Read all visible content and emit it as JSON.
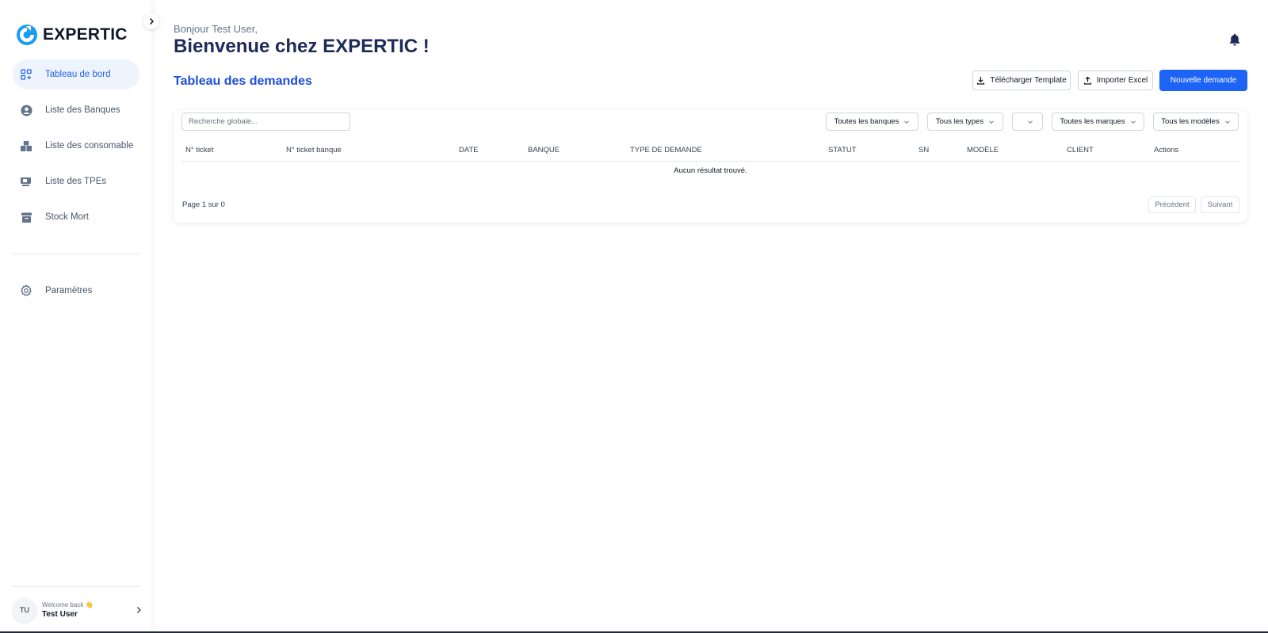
{
  "brand": {
    "name": "EXPERTIC",
    "color": "#1d9bf0"
  },
  "sidebar": {
    "items": [
      {
        "label": "Tableau de bord",
        "icon": "dashboard-grid-icon",
        "active": true
      },
      {
        "label": "Liste des Banques",
        "icon": "user-circle-icon",
        "active": false
      },
      {
        "label": "Liste des consomable",
        "icon": "boxes-icon",
        "active": false
      },
      {
        "label": "Liste des TPEs",
        "icon": "terminal-card-icon",
        "active": false
      },
      {
        "label": "Stock Mort",
        "icon": "archive-box-icon",
        "active": false
      }
    ],
    "settings_label": "Paramètres"
  },
  "user": {
    "initials": "TU",
    "welcome": "Welcome back 👋",
    "name": "Test User"
  },
  "header": {
    "greeting": "Bonjour Test User,",
    "title": "Bienvenue chez EXPERTIC !"
  },
  "section": {
    "title": "Tableau des demandes"
  },
  "actions": {
    "download_template": "Télécharger Template",
    "import_excel": "Importer Excel",
    "new_request": "Nouvelle demande"
  },
  "filters": {
    "search_placeholder": "Recherche globale...",
    "banks": "Toutes les banques",
    "types": "Tous les types",
    "status": "",
    "brands": "Toutes les marques",
    "models": "Tous les modèles"
  },
  "table": {
    "columns": [
      "N° ticket",
      "N° ticket banque",
      "DATE",
      "BANQUE",
      "TYPE DE DEMANDE",
      "STATUT",
      "SN",
      "MODÈLE",
      "CLIENT",
      "Actions"
    ],
    "empty_message": "Aucun résultat trouvé."
  },
  "pagination": {
    "info": "Page 1 sur 0",
    "previous": "Précédent",
    "next": "Suivant"
  },
  "colors": {
    "primary": "#1d63f5",
    "title": "#1e2a5a",
    "active_bg": "#eef4fd"
  }
}
